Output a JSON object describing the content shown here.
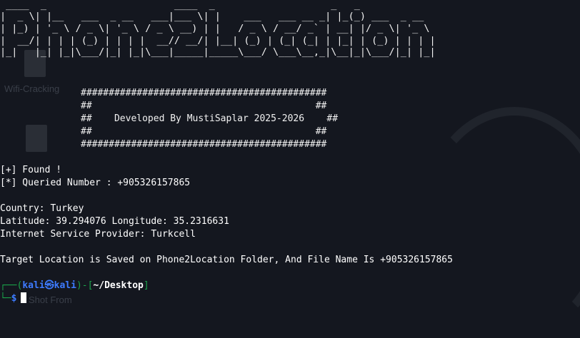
{
  "desktop": {
    "icon1_label": "Wifi-Cracking",
    "icon2_label": "Shot From"
  },
  "ascii_banner": [
    " ____  _                      ____  _                    _   _             ",
    "|  _ \\| |__   ___  _ __   ___|___ \\| |    ___   ___ __ _| |_(_) ___  _ __  ",
    "| |_) | '_ \\ / _ \\| '_ \\ / _ \\ __) | |   / _ \\ / __/ _` | __| |/ _ \\| '_ \\ ",
    "|  __/| | | | (_) | | | |  __// __/| |__| (_) | (_| (_| | |_| | (_) | | | |",
    "|_|   |_| |_|\\___/|_| |_|\\___|_____|_____\\___/ \\___\\__,_|\\__|_|\\___/|_| |_|"
  ],
  "developer_box": [
    "############################################",
    "##                                        ##",
    "##    Developed By MustiSaplar 2025-2026    ##",
    "##                                        ##",
    "############################################"
  ],
  "output": {
    "found": "[+] Found !",
    "queried": "[*] Queried Number : +905326157865",
    "country": "Country: Turkey",
    "coords": "Latitude: 39.294076 Longitude: 35.2316631",
    "isp": "Internet Service Provider: Turkcell",
    "saved": "Target Location is Saved on Phone2Location Folder, And File Name Is +905326157865"
  },
  "prompt": {
    "top_left": "┌──(",
    "user": "kali㉿kali",
    "mid": ")-[",
    "dir": "~/Desktop",
    "end": "]",
    "bottom_left": "└─",
    "dollar": "$"
  }
}
